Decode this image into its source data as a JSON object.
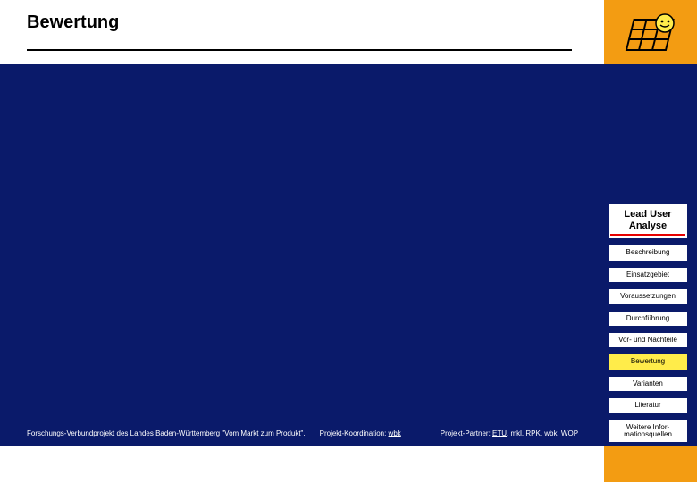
{
  "title": "Bewertung",
  "logo_name": "grid-logo",
  "panel": {
    "header_line1": "Lead User",
    "header_line2": "Analyse"
  },
  "nav": [
    {
      "label": "Beschreibung",
      "active": false
    },
    {
      "label": "Einsatzgebiet",
      "active": false
    },
    {
      "label": "Voraussetzungen",
      "active": false
    },
    {
      "label": "Durchführung",
      "active": false
    },
    {
      "label": "Vor- und Nachteile",
      "active": false
    },
    {
      "label": "Bewertung",
      "active": true
    },
    {
      "label": "Varianten",
      "active": false
    },
    {
      "label": "Literatur",
      "active": false
    },
    {
      "label": "Weitere Infor-\nmationsquellen",
      "active": false
    }
  ],
  "footer": {
    "seg1": "Forschungs-Verbundprojekt des Landes Baden-Württemberg \"Vom Markt zum Produkt\".",
    "seg2_prefix": "Projekt-Koordination: ",
    "seg2_link": "wbk",
    "seg3_prefix": "Projekt-Partner: ",
    "seg3_link": "ETU",
    "seg3_rest": ", mkl, RPK, wbk, WOP"
  }
}
